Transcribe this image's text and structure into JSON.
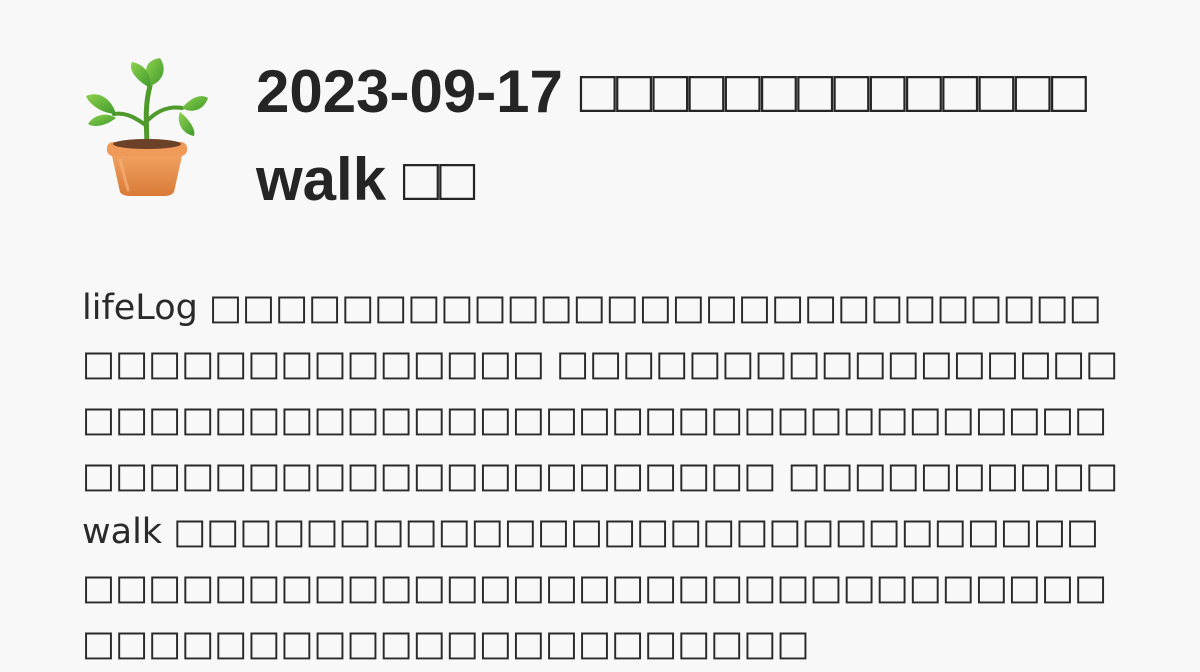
{
  "post": {
    "icon": "potted-plant-icon",
    "title": "2023-09-17 □□□□□□□□□□□□□□ walk □□",
    "excerpt": "lifeLog □□□□□□□□□□□□□□□□□□□□□□□□□□□□□□□□□□□□□□□□□ □□□□□□□□□□□□□□□□□□□□□□□□□□□□□□□□□□□□□□□□□□□□□□□□□□□□□□□□□□□□□□□□□□□□□ □□□□□□□□□□ walk □□□□□□□□□□□□□□□□□□□□□□□□□□□□□□□□□□□□□□□□□□□□□□□□□□□□□□□□□□□□□□□□□□□□□□□□□□□□□□□□□"
  },
  "colors": {
    "background": "#f8f8f9",
    "text": "#252525"
  }
}
